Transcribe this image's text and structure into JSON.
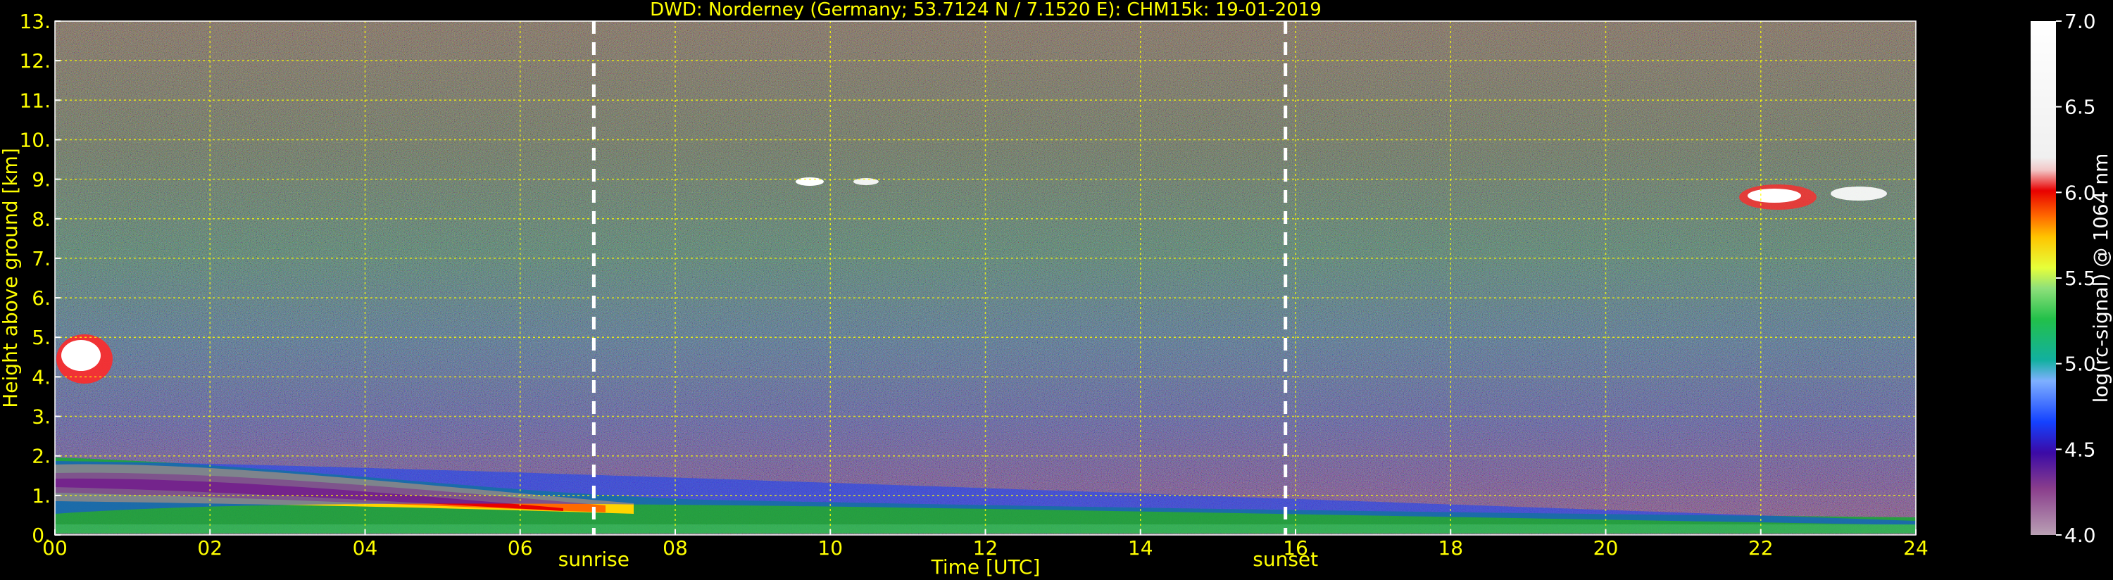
{
  "chart_data": {
    "type": "heatmap",
    "title": "DWD: Norderney (Germany; 53.7124 N / 7.1520 E):    CHM15k: 19-01-2019",
    "xlabel": "Time [UTC]",
    "ylabel": "Height above ground [km]",
    "xlim": [
      0,
      24
    ],
    "ylim": [
      0,
      13
    ],
    "x_ticks": [
      "00",
      "02",
      "04",
      "06",
      "08",
      "10",
      "12",
      "14",
      "16",
      "18",
      "20",
      "22",
      "24"
    ],
    "y_ticks": [
      "0.",
      "1.",
      "2.",
      "3.",
      "4.",
      "5.",
      "6.",
      "7.",
      "8.",
      "9.",
      "10.",
      "11.",
      "12.",
      "13."
    ],
    "grid": true,
    "markers": [
      {
        "label": "sunrise",
        "x": 6.95
      },
      {
        "label": "sunset",
        "x": 15.87
      }
    ],
    "colorbar": {
      "label": "log(rc-signal) @ 1064 nm",
      "range": [
        4.0,
        7.0
      ],
      "ticks": [
        "4.0",
        "4.5",
        "5.0",
        "5.5",
        "6.0",
        "6.5",
        "7.0"
      ]
    }
  }
}
